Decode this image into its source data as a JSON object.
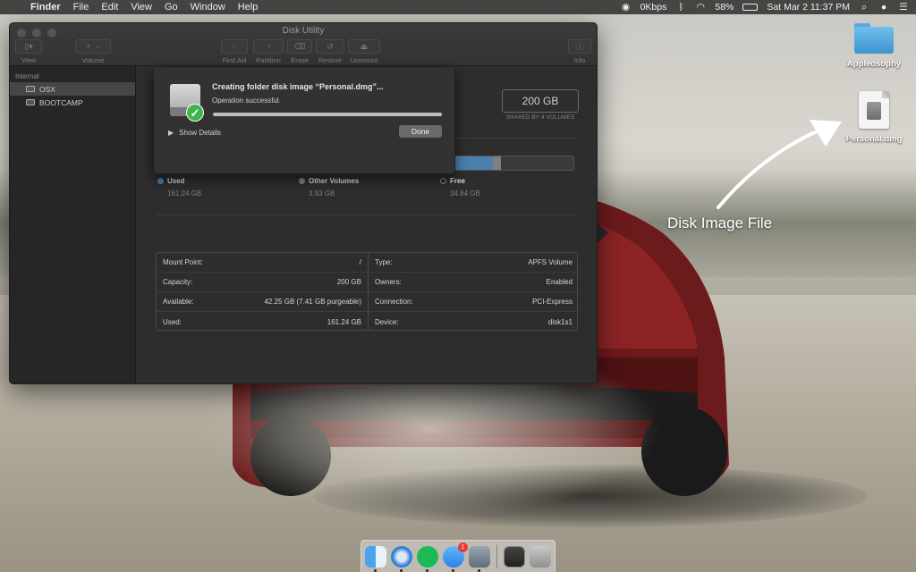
{
  "menubar": {
    "app": "Finder",
    "items": [
      "File",
      "Edit",
      "View",
      "Go",
      "Window",
      "Help"
    ],
    "network": "0Kbps",
    "battery_percent": "58%",
    "battery_level": 0.58,
    "clock": "Sat Mar 2  11:37 PM"
  },
  "desktop": {
    "folder_label": "Appleosophy",
    "dmg_label": "Personal.dmg",
    "annotation": "Disk Image File"
  },
  "window": {
    "title": "Disk Utility",
    "toolbar": {
      "view": "View",
      "volume": "Volume",
      "first_aid": "First Aid",
      "partition": "Partition",
      "erase": "Erase",
      "restore": "Restore",
      "unmount": "Unmount",
      "info": "Info"
    },
    "sidebar": {
      "section": "Internal",
      "items": [
        {
          "label": "OSX",
          "selected": true
        },
        {
          "label": "BOOTCAMP",
          "selected": false
        }
      ]
    },
    "capacity": {
      "value": "200 GB",
      "subtitle": "SHARED BY 4 VOLUMES"
    },
    "usage": {
      "used": {
        "label": "Used",
        "value": "161.24 GB",
        "color": "#4a7fae",
        "fraction": 0.806
      },
      "other": {
        "label": "Other Volumes",
        "value": "3.93 GB",
        "color": "#808080",
        "fraction": 0.0197
      },
      "free": {
        "label": "Free",
        "value": "34.84 GB",
        "color": "#3a3a3a"
      }
    },
    "info": {
      "left": [
        {
          "label": "Mount Point:",
          "value": "/"
        },
        {
          "label": "Capacity:",
          "value": "200 GB"
        },
        {
          "label": "Available:",
          "value": "42.25 GB (7.41 GB purgeable)"
        },
        {
          "label": "Used:",
          "value": "161.24 GB"
        }
      ],
      "right": [
        {
          "label": "Type:",
          "value": "APFS Volume"
        },
        {
          "label": "Owners:",
          "value": "Enabled"
        },
        {
          "label": "Connection:",
          "value": "PCI-Express"
        },
        {
          "label": "Device:",
          "value": "disk1s1"
        }
      ]
    },
    "sheet": {
      "title": "Creating folder disk image “Personal.dmg”...",
      "status": "Operation successful.",
      "progress": 1.0,
      "show_details": "Show Details",
      "done": "Done"
    }
  },
  "dock": {
    "apps": [
      "Finder",
      "Safari",
      "Spotify",
      "Messages",
      "Preview",
      "Terminal",
      "Trash"
    ],
    "messages_badge": "1"
  }
}
